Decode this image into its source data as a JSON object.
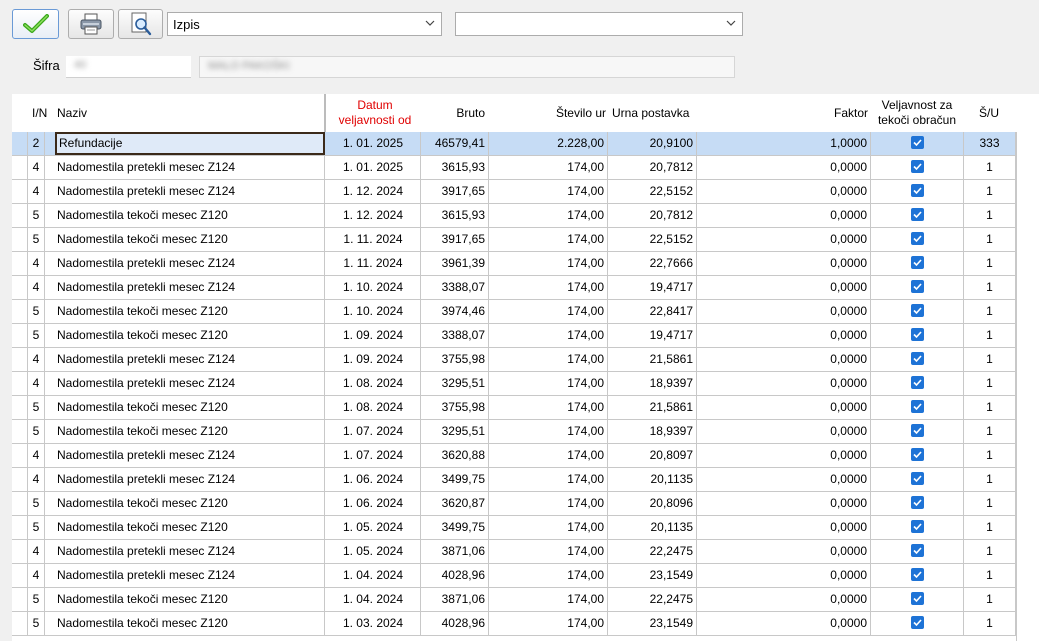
{
  "toolbar": {
    "icons": {
      "ok": "checkmark-icon",
      "print": "printer-icon",
      "preview": "print-preview-icon",
      "dropdown": "chevron-down-icon"
    },
    "combo1_value": "Izpis",
    "combo2_value": ""
  },
  "sifra": {
    "label": "Šifra",
    "code_blurred": "40",
    "name_blurred": "MALO PAKOŠKI"
  },
  "table": {
    "headers": {
      "in": "I/N",
      "naziv": "Naziv",
      "datum_line1": "Datum",
      "datum_line2": "veljavnosti od",
      "bruto": "Bruto",
      "stevilo_ur": "Število ur",
      "urna_postavka": "Urna postavka",
      "faktor": "Faktor",
      "veljavnost_line1": "Veljavnost za",
      "veljavnost_line2": "tekoči obračun",
      "su": "Š/U"
    },
    "colors": {
      "header_red": "#e00000",
      "selected_row": "#c6dcf5",
      "checkbox": "#1e73d6"
    },
    "rows": [
      {
        "in": "2",
        "naziv": "Refundacije",
        "datum": "1. 01. 2025",
        "bruto": "46579,41",
        "ur": "2.228,00",
        "postavka": "20,9100",
        "faktor": "1,0000",
        "veljavnost": true,
        "su": "333"
      },
      {
        "in": "4",
        "naziv": "Nadomestila pretekli mesec Z124",
        "datum": "1. 01. 2025",
        "bruto": "3615,93",
        "ur": "174,00",
        "postavka": "20,7812",
        "faktor": "0,0000",
        "veljavnost": true,
        "su": "1"
      },
      {
        "in": "4",
        "naziv": "Nadomestila pretekli mesec Z124",
        "datum": "1. 12. 2024",
        "bruto": "3917,65",
        "ur": "174,00",
        "postavka": "22,5152",
        "faktor": "0,0000",
        "veljavnost": true,
        "su": "1"
      },
      {
        "in": "5",
        "naziv": "Nadomestila tekoči mesec Z120",
        "datum": "1. 12. 2024",
        "bruto": "3615,93",
        "ur": "174,00",
        "postavka": "20,7812",
        "faktor": "0,0000",
        "veljavnost": true,
        "su": "1"
      },
      {
        "in": "5",
        "naziv": "Nadomestila tekoči mesec Z120",
        "datum": "1. 11. 2024",
        "bruto": "3917,65",
        "ur": "174,00",
        "postavka": "22,5152",
        "faktor": "0,0000",
        "veljavnost": true,
        "su": "1"
      },
      {
        "in": "4",
        "naziv": "Nadomestila pretekli mesec Z124",
        "datum": "1. 11. 2024",
        "bruto": "3961,39",
        "ur": "174,00",
        "postavka": "22,7666",
        "faktor": "0,0000",
        "veljavnost": true,
        "su": "1"
      },
      {
        "in": "4",
        "naziv": "Nadomestila pretekli mesec Z124",
        "datum": "1. 10. 2024",
        "bruto": "3388,07",
        "ur": "174,00",
        "postavka": "19,4717",
        "faktor": "0,0000",
        "veljavnost": true,
        "su": "1"
      },
      {
        "in": "5",
        "naziv": "Nadomestila tekoči mesec Z120",
        "datum": "1. 10. 2024",
        "bruto": "3974,46",
        "ur": "174,00",
        "postavka": "22,8417",
        "faktor": "0,0000",
        "veljavnost": true,
        "su": "1"
      },
      {
        "in": "5",
        "naziv": "Nadomestila tekoči mesec Z120",
        "datum": "1. 09. 2024",
        "bruto": "3388,07",
        "ur": "174,00",
        "postavka": "19,4717",
        "faktor": "0,0000",
        "veljavnost": true,
        "su": "1"
      },
      {
        "in": "4",
        "naziv": "Nadomestila pretekli mesec Z124",
        "datum": "1. 09. 2024",
        "bruto": "3755,98",
        "ur": "174,00",
        "postavka": "21,5861",
        "faktor": "0,0000",
        "veljavnost": true,
        "su": "1"
      },
      {
        "in": "4",
        "naziv": "Nadomestila pretekli mesec Z124",
        "datum": "1. 08. 2024",
        "bruto": "3295,51",
        "ur": "174,00",
        "postavka": "18,9397",
        "faktor": "0,0000",
        "veljavnost": true,
        "su": "1"
      },
      {
        "in": "5",
        "naziv": "Nadomestila tekoči mesec Z120",
        "datum": "1. 08. 2024",
        "bruto": "3755,98",
        "ur": "174,00",
        "postavka": "21,5861",
        "faktor": "0,0000",
        "veljavnost": true,
        "su": "1"
      },
      {
        "in": "5",
        "naziv": "Nadomestila tekoči mesec Z120",
        "datum": "1. 07. 2024",
        "bruto": "3295,51",
        "ur": "174,00",
        "postavka": "18,9397",
        "faktor": "0,0000",
        "veljavnost": true,
        "su": "1"
      },
      {
        "in": "4",
        "naziv": "Nadomestila pretekli mesec Z124",
        "datum": "1. 07. 2024",
        "bruto": "3620,88",
        "ur": "174,00",
        "postavka": "20,8097",
        "faktor": "0,0000",
        "veljavnost": true,
        "su": "1"
      },
      {
        "in": "4",
        "naziv": "Nadomestila pretekli mesec Z124",
        "datum": "1. 06. 2024",
        "bruto": "3499,75",
        "ur": "174,00",
        "postavka": "20,1135",
        "faktor": "0,0000",
        "veljavnost": true,
        "su": "1"
      },
      {
        "in": "5",
        "naziv": "Nadomestila tekoči mesec Z120",
        "datum": "1. 06. 2024",
        "bruto": "3620,87",
        "ur": "174,00",
        "postavka": "20,8096",
        "faktor": "0,0000",
        "veljavnost": true,
        "su": "1"
      },
      {
        "in": "5",
        "naziv": "Nadomestila tekoči mesec Z120",
        "datum": "1. 05. 2024",
        "bruto": "3499,75",
        "ur": "174,00",
        "postavka": "20,1135",
        "faktor": "0,0000",
        "veljavnost": true,
        "su": "1"
      },
      {
        "in": "4",
        "naziv": "Nadomestila pretekli mesec Z124",
        "datum": "1. 05. 2024",
        "bruto": "3871,06",
        "ur": "174,00",
        "postavka": "22,2475",
        "faktor": "0,0000",
        "veljavnost": true,
        "su": "1"
      },
      {
        "in": "4",
        "naziv": "Nadomestila pretekli mesec Z124",
        "datum": "1. 04. 2024",
        "bruto": "4028,96",
        "ur": "174,00",
        "postavka": "23,1549",
        "faktor": "0,0000",
        "veljavnost": true,
        "su": "1"
      },
      {
        "in": "5",
        "naziv": "Nadomestila tekoči mesec Z120",
        "datum": "1. 04. 2024",
        "bruto": "3871,06",
        "ur": "174,00",
        "postavka": "22,2475",
        "faktor": "0,0000",
        "veljavnost": true,
        "su": "1"
      },
      {
        "in": "5",
        "naziv": "Nadomestila tekoči mesec Z120",
        "datum": "1. 03. 2024",
        "bruto": "4028,96",
        "ur": "174,00",
        "postavka": "23,1549",
        "faktor": "0,0000",
        "veljavnost": true,
        "su": "1"
      }
    ]
  }
}
